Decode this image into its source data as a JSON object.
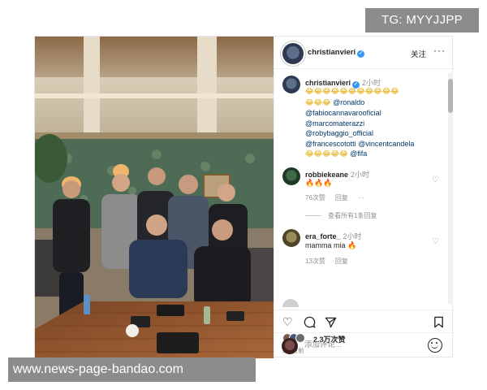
{
  "watermark": {
    "top": "TG: MYYJJPP",
    "bottom": "www.news-page-bandao.com"
  },
  "post": {
    "username": "christianvieri",
    "follow_label": "关注",
    "more_label": "···",
    "caption": {
      "username": "christianvieri",
      "time": "2小时",
      "emoji_row1": "😂😂😂😂😂😂😂😂😂😂😂",
      "emoji_row2": "😂😂😂",
      "mentions": {
        "ronaldo": "@ronaldo",
        "cannavaro": "@fabiocannavarooficial",
        "materazzi": "@marcomaterazzi",
        "baggio": "@robybaggio_official",
        "totti": "@francescototti",
        "candela": "@vincentcandela",
        "fifa": "@fifa"
      },
      "emoji_row3": "😂😂😂😂😂"
    },
    "comments": [
      {
        "username": "robbiekeane",
        "time": "2小时",
        "text": "🔥🔥🔥",
        "likes": "76次赞",
        "reply": "回复",
        "more": "···",
        "view_replies": "查看所有1条回复"
      },
      {
        "username": "era_forte_",
        "time": "2小时",
        "text": "mamma mia",
        "text_emoji": "🔥",
        "likes": "13次赞",
        "reply": "回复"
      }
    ],
    "icons": {
      "like": "heart-icon",
      "comment": "comment-icon",
      "share": "send-icon",
      "save": "bookmark-icon",
      "emoji": "smiley-icon"
    },
    "likes_count": "2.3万次赞",
    "time_ago": "2小时前",
    "add_comment_placeholder": "添加评论..."
  }
}
